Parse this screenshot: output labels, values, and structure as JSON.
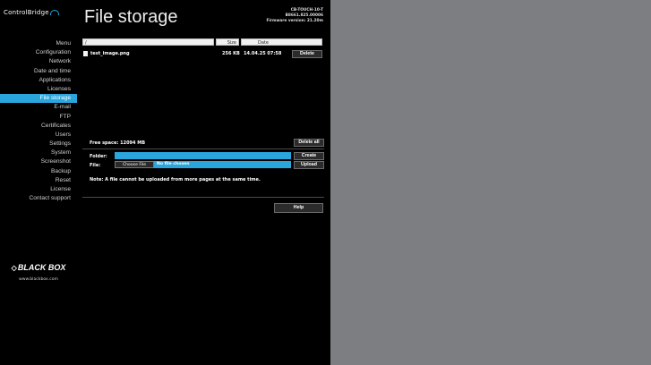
{
  "brand": {
    "logo_text": "ControlBridge",
    "company": "BLACK BOX",
    "company_mark": "◇",
    "url": "www.blackbox.com"
  },
  "device": {
    "model": "CB-TOUCH-10-T",
    "serial": "B8661.825.00006",
    "firmware": "Firmware version: 21.20m"
  },
  "page": {
    "title": "File storage"
  },
  "menu": {
    "items": [
      {
        "label": "Menu"
      },
      {
        "label": "Configuration"
      },
      {
        "label": "Network"
      },
      {
        "label": "Date and time"
      },
      {
        "label": "Applications"
      },
      {
        "label": "Licenses"
      },
      {
        "label": "File storage"
      },
      {
        "label": "E-mail"
      },
      {
        "label": "FTP"
      },
      {
        "label": "Certificates"
      },
      {
        "label": "Users"
      },
      {
        "label": "Settings"
      },
      {
        "label": "System"
      },
      {
        "label": "Screenshot"
      },
      {
        "label": "Backup"
      },
      {
        "label": "Reset"
      },
      {
        "label": "License"
      },
      {
        "label": "Contact support"
      }
    ],
    "active": "File storage"
  },
  "table": {
    "path": "/",
    "headers": {
      "size": "Size",
      "date": "Date"
    },
    "rows": [
      {
        "name": "test_image.png",
        "size": "256 KB",
        "date": "14.04.25 07:58",
        "action": "Delete"
      }
    ]
  },
  "storage": {
    "free_space": "Free space: 12094 MB",
    "delete_all": "Delete all"
  },
  "folder": {
    "label": "Folder:",
    "value": "",
    "create": "Create"
  },
  "upload": {
    "label": "File:",
    "choose": "Choose File",
    "status": "No file chosen",
    "upload": "Upload"
  },
  "note": "Note: A file cannot be uploaded from more pages at the same time.",
  "help": "Help",
  "colors": {
    "accent": "#2aa6dd",
    "sidebar_bg": "#000000",
    "page_bg": "#7d7e82"
  }
}
